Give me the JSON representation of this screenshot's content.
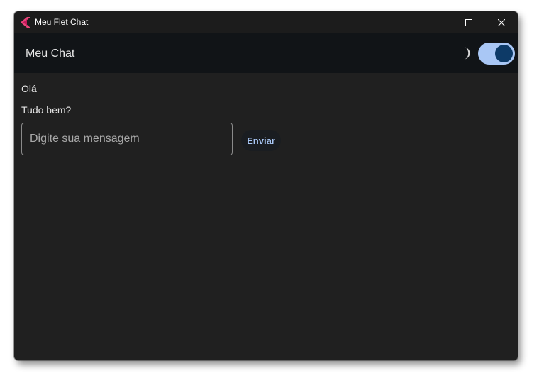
{
  "window": {
    "title": "Meu Flet Chat",
    "icon": "flet-logo-icon",
    "controls": [
      "minimize-icon",
      "maximize-icon",
      "close-icon"
    ]
  },
  "appbar": {
    "title": "Meu Chat",
    "theme_icon": "moon-icon",
    "dark_mode_switch": "on"
  },
  "messages": [
    {
      "text": "Olá"
    },
    {
      "text": "Tudo bem?"
    }
  ],
  "composer": {
    "placeholder": "Digite sua mensagem",
    "value": "",
    "send_label": "Enviar"
  },
  "colors": {
    "window_bg": "#202020",
    "titlebar_bg": "#1c1c1c",
    "appbar_bg": "#111417",
    "accent": "#a9c7f5",
    "switch_thumb": "#0d3a67",
    "app_icon_pink": "#e9457a",
    "app_icon_red": "#c2185b"
  }
}
